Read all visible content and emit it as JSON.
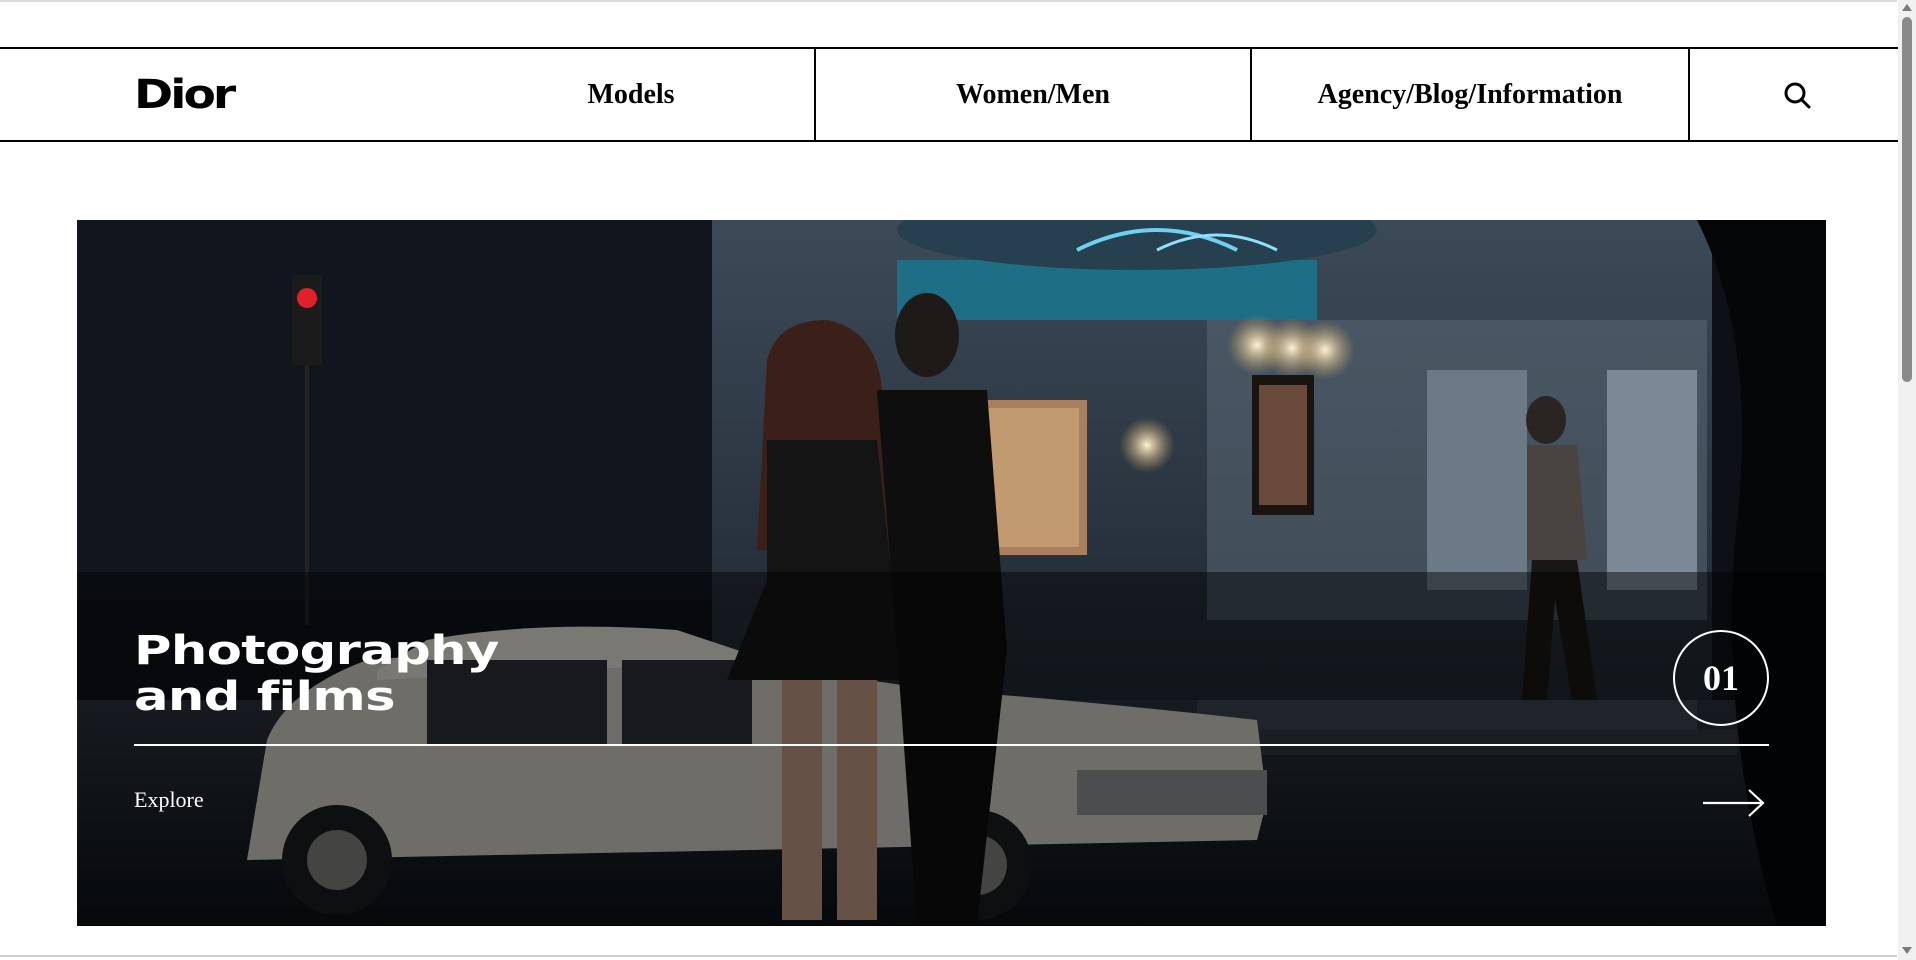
{
  "brand": {
    "logo_text": "Dior"
  },
  "nav": {
    "items": [
      {
        "label": "Models"
      },
      {
        "label": "Women/Men"
      },
      {
        "label": "Agency/Blog/Information"
      }
    ],
    "search_icon": "search-icon"
  },
  "hero": {
    "title": "Photography\nand films",
    "number": "01",
    "link_label": "Explore",
    "arrow_icon": "arrow-right-icon"
  }
}
